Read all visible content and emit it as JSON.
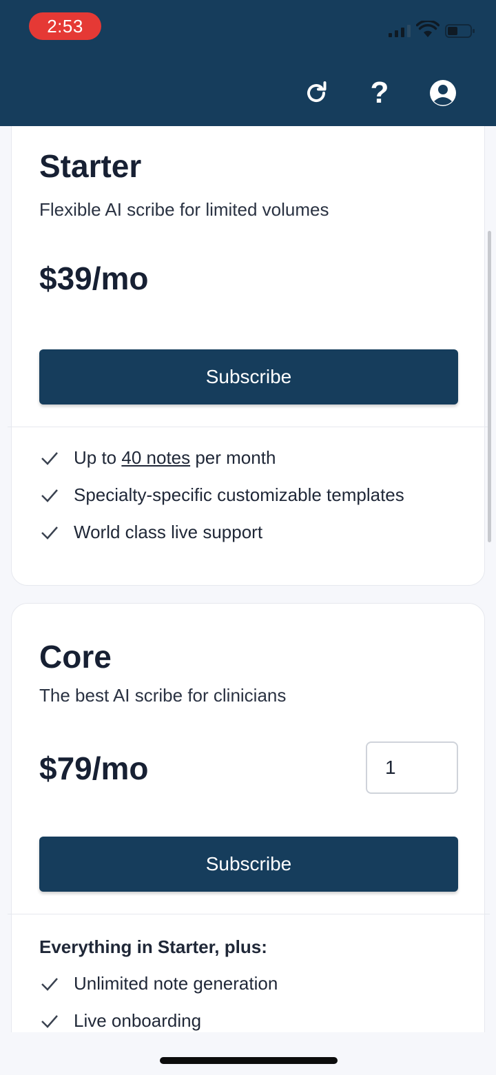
{
  "status_bar": {
    "time": "2:53"
  },
  "header": {
    "refresh_icon": "refresh-icon",
    "help_label": "?",
    "account_icon": "account-icon"
  },
  "plans": [
    {
      "name": "Starter",
      "description": "Flexible AI scribe for limited volumes",
      "price": "$39/mo",
      "subscribe_label": "Subscribe",
      "features": [
        {
          "prefix": "Up to ",
          "link": "40 notes",
          "suffix": " per month"
        },
        {
          "text": "Specialty-specific customizable templates"
        },
        {
          "text": "World class live support"
        }
      ]
    },
    {
      "name": "Core",
      "description": "The best AI scribe for clinicians",
      "price": "$79/mo",
      "quantity": "1",
      "subscribe_label": "Subscribe",
      "features_heading": "Everything in Starter, plus:",
      "features": [
        {
          "text": "Unlimited note generation"
        },
        {
          "text": "Live onboarding"
        }
      ]
    }
  ],
  "colors": {
    "header_bg": "#163d5c",
    "button_bg": "#163d5c",
    "time_pill": "#e53935"
  }
}
